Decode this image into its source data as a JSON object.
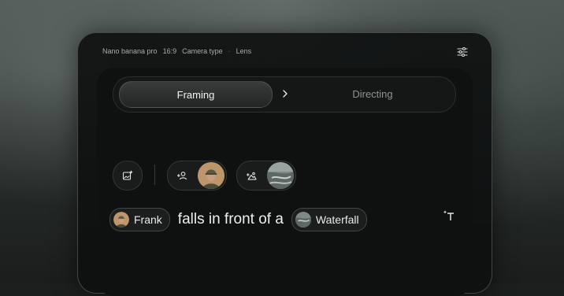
{
  "topbar": {
    "model": "Nano banana pro",
    "aspect": "16:9",
    "camera": "Camera type",
    "lens": "Lens",
    "settings_icon": "sliders-icon"
  },
  "tabs": {
    "framing": "Framing",
    "directing": "Directing",
    "active": "Framing"
  },
  "toolbar": {
    "add_image_icon": "add-image-icon",
    "add_character_icon": "add-person-icon",
    "add_location_icon": "add-landscape-icon"
  },
  "prompt": {
    "subject": "Frank",
    "action": "falls in front of a",
    "location": "Waterfall"
  },
  "colors": {
    "accent_text": "#eef0ef",
    "panel": "#0f1010",
    "chip_bg": "#1c1d1d"
  }
}
